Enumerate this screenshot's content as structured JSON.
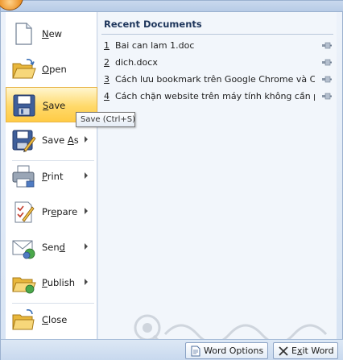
{
  "menu": {
    "items": [
      {
        "label": "New",
        "key": "N",
        "rest": "ew",
        "has_submenu": false,
        "icon": "new-document-icon"
      },
      {
        "label": "Open",
        "key": "O",
        "rest": "pen",
        "has_submenu": false,
        "icon": "open-folder-icon"
      },
      {
        "label": "Save",
        "key": "S",
        "rest": "ave",
        "has_submenu": false,
        "icon": "floppy-disk-icon"
      },
      {
        "label": "Save As",
        "pre": "Save ",
        "key": "A",
        "rest": "s",
        "has_submenu": true,
        "icon": "save-as-icon"
      },
      {
        "label": "Print",
        "key": "P",
        "rest": "rint",
        "has_submenu": true,
        "icon": "printer-icon"
      },
      {
        "label": "Prepare",
        "pre": "Pr",
        "key": "e",
        "rest": "pare",
        "has_submenu": true,
        "icon": "prepare-icon"
      },
      {
        "label": "Send",
        "pre": "Sen",
        "key": "d",
        "rest": "",
        "has_submenu": true,
        "icon": "send-icon"
      },
      {
        "label": "Publish",
        "key": "P",
        "pre": "",
        "rest": "ublish",
        "has_submenu": true,
        "icon": "publish-icon"
      },
      {
        "label": "Close",
        "key": "C",
        "rest": "lose",
        "has_submenu": false,
        "icon": "close-folder-icon"
      }
    ]
  },
  "recent": {
    "title": "Recent Documents",
    "documents": [
      {
        "num": "1",
        "name": "Bai can lam 1.doc"
      },
      {
        "num": "2",
        "name": "dich.docx"
      },
      {
        "num": "3",
        "name": "Cách lưu bookmark trên Google Chrome và Cố..."
      },
      {
        "num": "4",
        "name": "Cách chặn website trên máy tính không cần p..."
      }
    ]
  },
  "tooltip": {
    "text": "Save (Ctrl+S)"
  },
  "footer": {
    "word_options": "Word Options",
    "exit_word": "Exit Word",
    "exit_pre": "E",
    "exit_key": "x",
    "exit_rest": "it Word"
  },
  "colors": {
    "active_highlight": "#ffd96a",
    "title_text": "#1d355b",
    "panel_bg": "#f2f6fb"
  }
}
